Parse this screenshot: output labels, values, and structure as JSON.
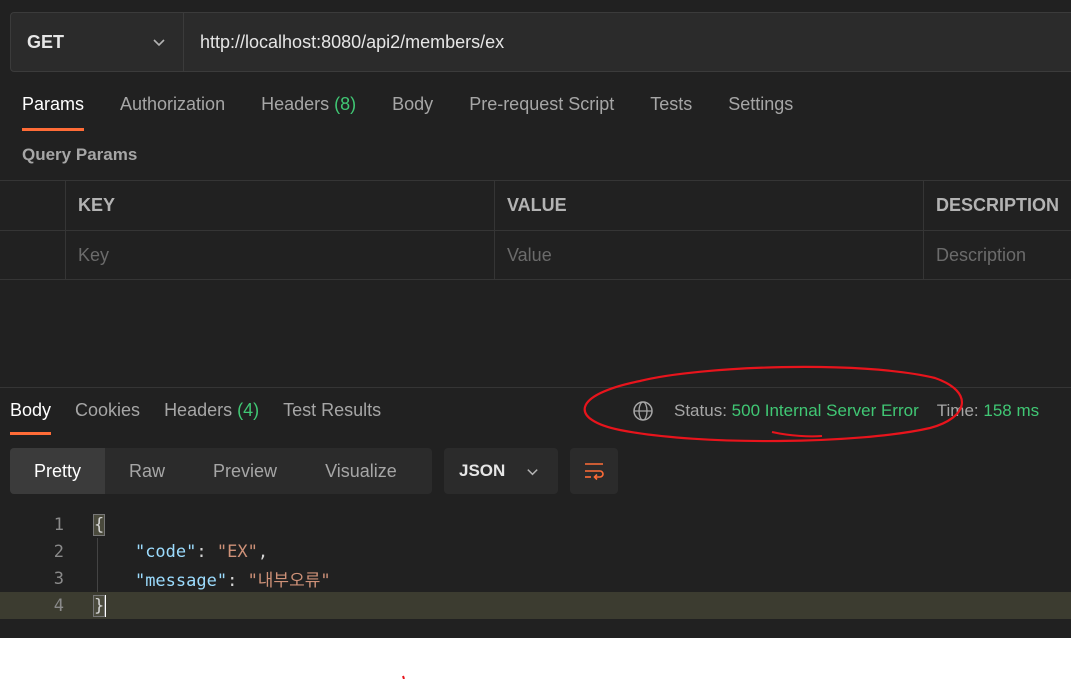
{
  "request": {
    "method": "GET",
    "url": "http://localhost:8080/api2/members/ex"
  },
  "request_tabs": [
    {
      "label": "Params",
      "count": "",
      "active": true
    },
    {
      "label": "Authorization",
      "count": ""
    },
    {
      "label": "Headers",
      "count": "(8)"
    },
    {
      "label": "Body",
      "count": ""
    },
    {
      "label": "Pre-request Script",
      "count": ""
    },
    {
      "label": "Tests",
      "count": ""
    },
    {
      "label": "Settings",
      "count": ""
    }
  ],
  "query_params": {
    "title": "Query Params",
    "columns": [
      "KEY",
      "VALUE",
      "DESCRIPTION"
    ],
    "placeholders": [
      "Key",
      "Value",
      "Description"
    ]
  },
  "response_tabs": [
    {
      "label": "Body",
      "count": "",
      "active": true
    },
    {
      "label": "Cookies",
      "count": ""
    },
    {
      "label": "Headers",
      "count": "(4)"
    },
    {
      "label": "Test Results",
      "count": ""
    }
  ],
  "status": {
    "status_label": "Status:",
    "status_value": "500 Internal Server Error",
    "time_label": "Time:",
    "time_value": "158 ms"
  },
  "view": {
    "modes": [
      "Pretty",
      "Raw",
      "Preview",
      "Visualize"
    ],
    "active_mode": "Pretty",
    "format": "JSON"
  },
  "code_lines": [
    {
      "num": "1",
      "text": "{"
    },
    {
      "num": "2",
      "key": "\"code\"",
      "value": "\"EX\"",
      "trail": ","
    },
    {
      "num": "3",
      "key": "\"message\"",
      "value": "\"내부오류\"",
      "trail": ""
    },
    {
      "num": "4",
      "text": "}"
    }
  ],
  "colors": {
    "accent": "#ff6c37",
    "success": "#40c774",
    "annotation": "#e8141c"
  }
}
